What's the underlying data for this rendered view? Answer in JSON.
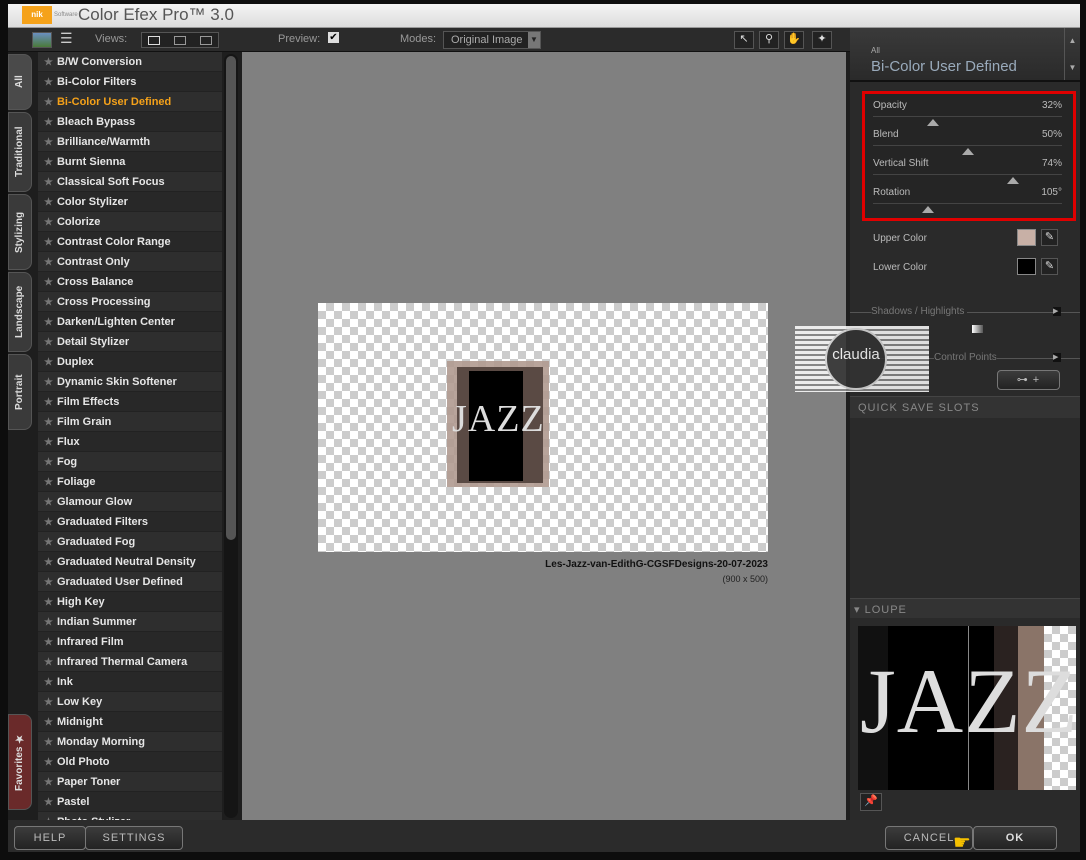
{
  "title": {
    "app": "Color Efex Pro™ 3.0",
    "logo": "nik",
    "logo_sub": "Software"
  },
  "toolbar": {
    "views_label": "Views:",
    "preview_label": "Preview:",
    "preview_checked": true,
    "modes_label": "Modes:",
    "modes_value": "Original Image"
  },
  "tabs": [
    "All",
    "Traditional",
    "Stylizing",
    "Landscape",
    "Portrait",
    "Favorites"
  ],
  "filters": [
    "B/W Conversion",
    "Bi-Color Filters",
    "Bi-Color User Defined",
    "Bleach Bypass",
    "Brilliance/Warmth",
    "Burnt Sienna",
    "Classical Soft Focus",
    "Color Stylizer",
    "Colorize",
    "Contrast Color Range",
    "Contrast Only",
    "Cross Balance",
    "Cross Processing",
    "Darken/Lighten Center",
    "Detail Stylizer",
    "Duplex",
    "Dynamic Skin Softener",
    "Film Effects",
    "Film Grain",
    "Flux",
    "Fog",
    "Foliage",
    "Glamour Glow",
    "Graduated Filters",
    "Graduated Fog",
    "Graduated Neutral Density",
    "Graduated User Defined",
    "High Key",
    "Indian Summer",
    "Infrared Film",
    "Infrared Thermal Camera",
    "Ink",
    "Low Key",
    "Midnight",
    "Monday Morning",
    "Old Photo",
    "Paper Toner",
    "Pastel",
    "Photo Stylizer"
  ],
  "active_filter": "Bi-Color User Defined",
  "preview": {
    "image_text": "JAZZ",
    "filename": "Les-Jazz-van-EdithG-CGSFDesigns-20-07-2023",
    "size": "(900 x 500)"
  },
  "panel": {
    "category": "All",
    "filter_name": "Bi-Color User Defined",
    "sliders": [
      {
        "label": "Opacity",
        "value": "32%",
        "level": 32
      },
      {
        "label": "Blend",
        "value": "50%",
        "level": 50
      },
      {
        "label": "Vertical Shift",
        "value": "74%",
        "level": 74
      },
      {
        "label": "Rotation",
        "value": "105°",
        "level": 29
      }
    ],
    "upper_color_label": "Upper Color",
    "upper_color": "#c8b0a6",
    "lower_color_label": "Lower Color",
    "lower_color": "#000000",
    "shadows_label": "Shadows / Highlights",
    "control_points_label": "Control Points",
    "quick_save_label": "QUICK SAVE SLOTS",
    "loupe_label": "LOUPE"
  },
  "watermark": "claudia",
  "bottom": {
    "help": "HELP",
    "settings": "SETTINGS",
    "cancel": "CANCEL",
    "ok": "OK"
  },
  "colors": {
    "accent": "#f5a21a",
    "highlight_box": "#e00000"
  }
}
